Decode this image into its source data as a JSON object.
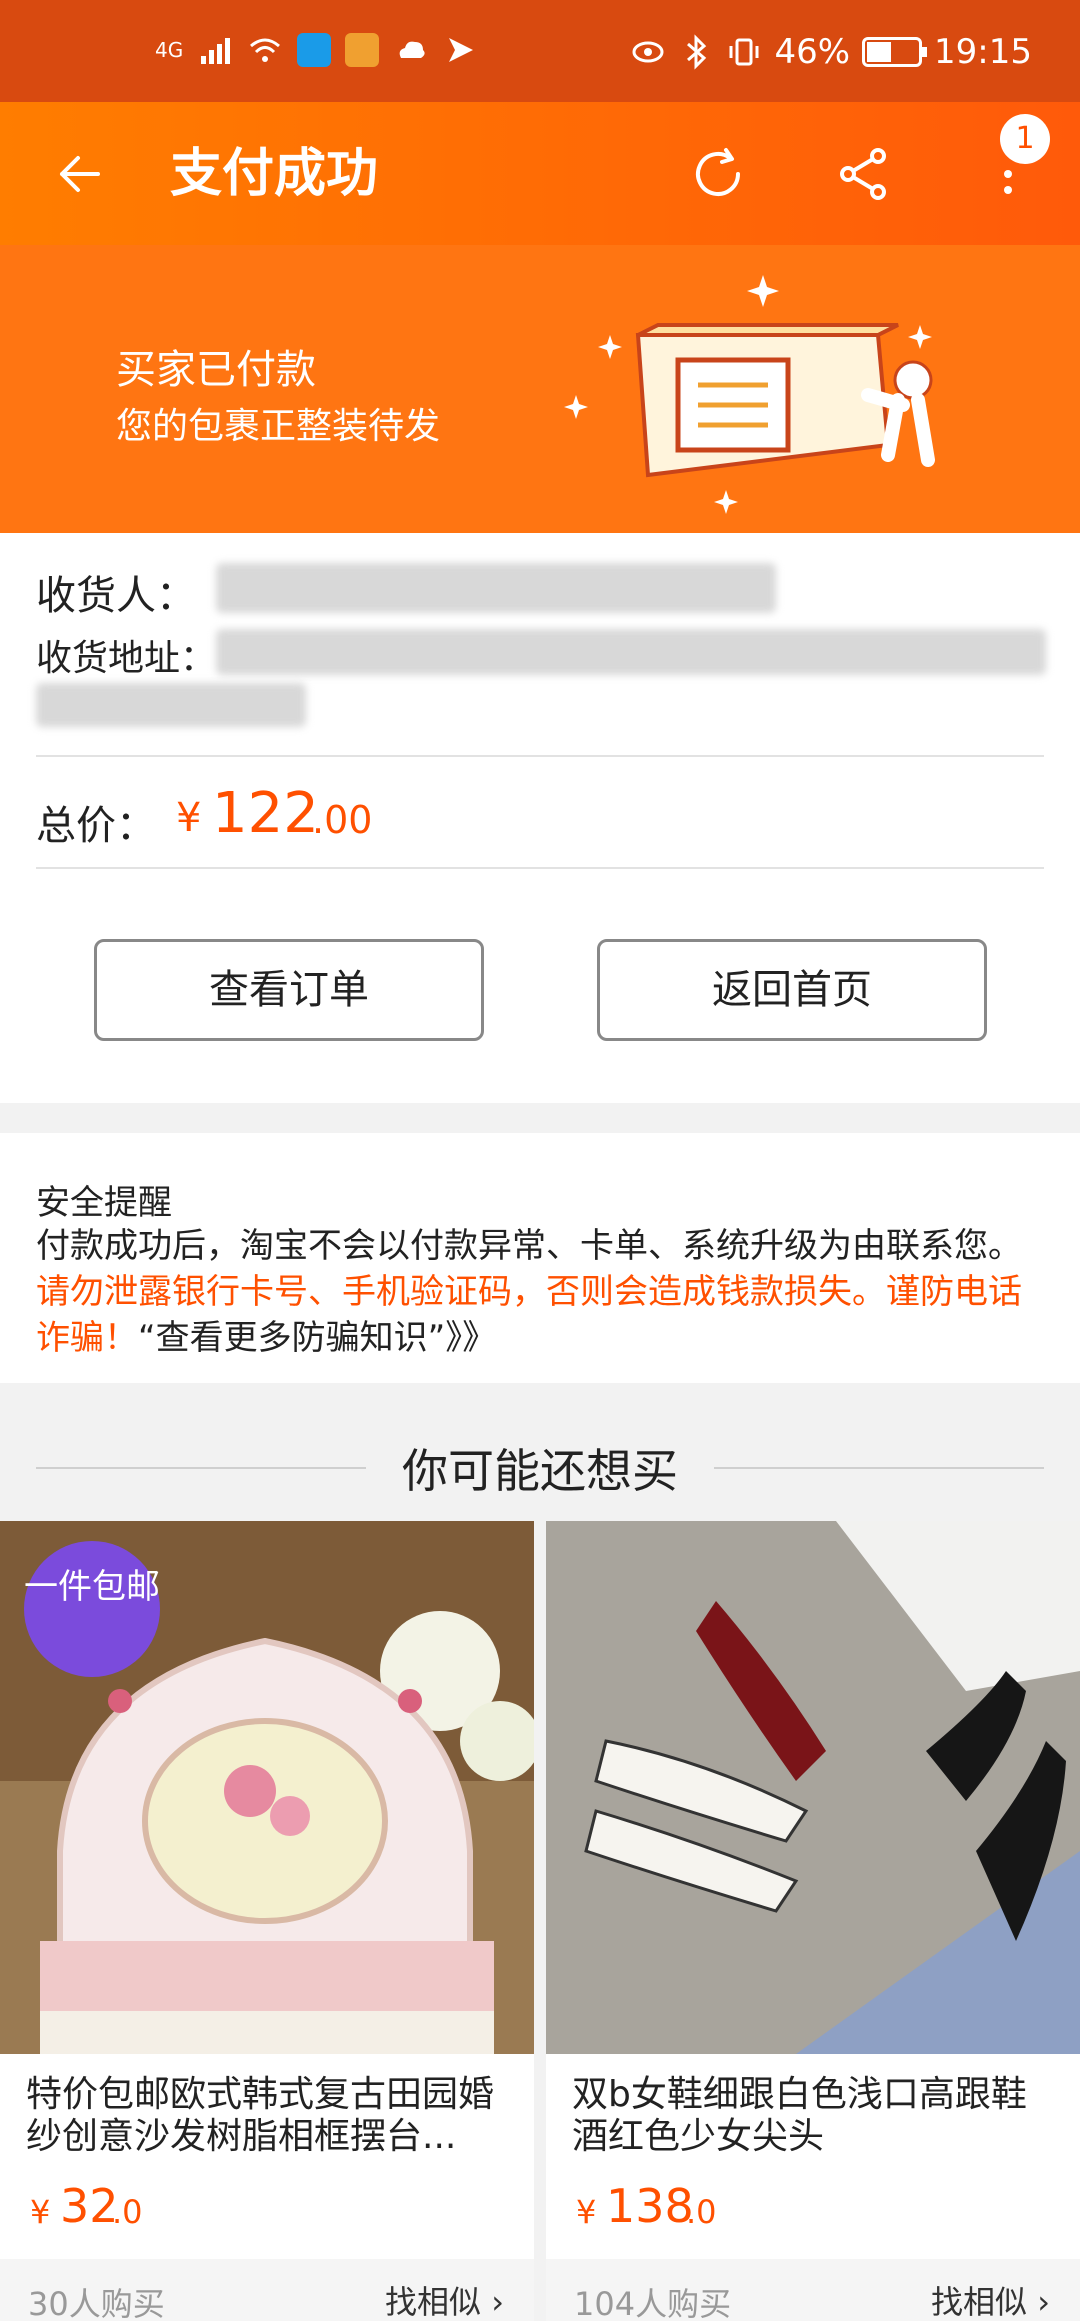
{
  "status_bar": {
    "network": "4G",
    "battery": "46%",
    "time": "19:15"
  },
  "nav": {
    "title": "支付成功",
    "badge_count": "1"
  },
  "banner": {
    "title": "买家已付款",
    "subtitle": "您的包裹正整装待发"
  },
  "order": {
    "receiver_label": "收货人：",
    "address_label": "收货地址：",
    "total_label": "总价：",
    "price_symbol": "¥",
    "price_int": "122",
    "price_dec": ".00"
  },
  "buttons": {
    "view_order": "查看订单",
    "back_home": "返回首页"
  },
  "safety": {
    "title": "安全提醒",
    "text_normal": "付款成功后，淘宝不会以付款异常、卡单、系统升级为由联系您。",
    "text_warning": "请勿泄露银行卡号、手机验证码，否则会造成钱款损失。谨防电话诈骗！",
    "text_link": "“查看更多防骗知识”》》"
  },
  "recommend": {
    "title": "你可能还想买",
    "products": [
      {
        "badge": "一件包邮",
        "title": "特价包邮欧式韩式复古田园婚纱创意沙发树脂相框摆台...",
        "price_symbol": "¥",
        "price_int": "32",
        "price_dec": ".0",
        "sales": "30人购买",
        "similar": "找相似 ›"
      },
      {
        "title": "双b女鞋细跟白色浅口高跟鞋酒红色少女尖头",
        "price_symbol": "¥",
        "price_int": "138",
        "price_dec": ".0",
        "sales": "104人购买",
        "similar": "找相似 ›"
      }
    ]
  },
  "colors": {
    "accent": "#ff5000",
    "nav_bg": "#ff7512",
    "status_bg": "#d84a10"
  }
}
